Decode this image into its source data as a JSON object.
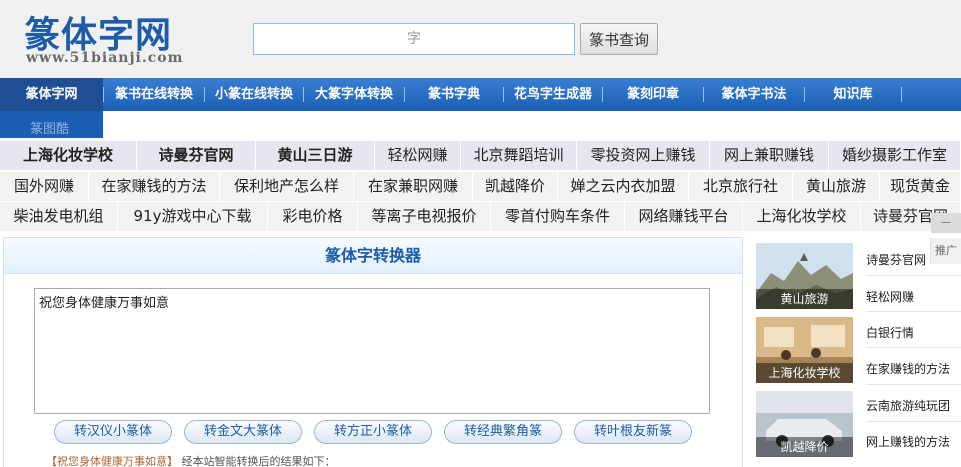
{
  "header": {
    "logo_title": "篆体字网",
    "logo_url": "www.51bianji.com",
    "search_placeholder": "字",
    "search_button": "篆书查询"
  },
  "nav": {
    "items": [
      "篆体字网",
      "篆书在线转换",
      "小篆在线转换",
      "大篆字体转换",
      "篆书字典",
      "花鸟字生成器",
      "篆刻印章",
      "篆体字书法",
      "知识库"
    ],
    "subnav": "篆图酷"
  },
  "links": {
    "row1": [
      "上海化妆学校",
      "诗曼芬官网",
      "黄山三日游",
      "轻松网赚",
      "北京舞蹈培训",
      "零投资网上赚钱",
      "网上兼职赚钱",
      "婚纱摄影工作室"
    ],
    "row2": [
      "国外网赚",
      "在家赚钱的方法",
      "保利地产怎么样",
      "在家兼职网赚",
      "凯越降价",
      "婵之云内衣加盟",
      "北京旅行社",
      "黄山旅游",
      "现货黄金"
    ],
    "row3": [
      "柴油发电机组",
      "91y游戏中心下载",
      "彩电价格",
      "等离子电视报价",
      "零首付购车条件",
      "网络赚钱平台",
      "上海化妆学校",
      "诗曼芬官网"
    ]
  },
  "converter": {
    "title": "篆体字转换器",
    "input_text": "祝您身体健康万事如意",
    "buttons": [
      "转汉仪小篆体",
      "转金文大篆体",
      "转方正小篆体",
      "转经典繁角篆",
      "转叶根友新篆"
    ],
    "result_quote": "【祝您身体健康万事如意】",
    "result_text": "经本站智能转换后的结果如下："
  },
  "sidebar": {
    "thumbs": [
      "黄山旅游",
      "上海化妆学校",
      "凯越降价"
    ],
    "links": [
      "诗曼芬官网",
      "轻松网赚",
      "白银行情",
      "在家赚钱的方法",
      "云南旅游纯玩团",
      "网上赚钱的方法"
    ]
  },
  "corner_tab": "推广",
  "scroll_tab": "—",
  "colors": {
    "brand_blue": "#1c5ca8",
    "nav_blue": "#1b5fb4",
    "nav_active": "#1e4f93"
  }
}
